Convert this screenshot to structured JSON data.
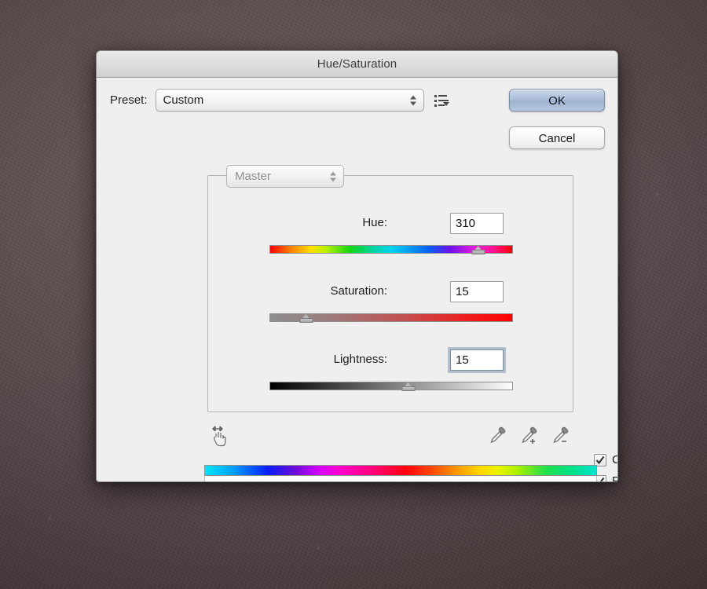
{
  "window": {
    "title": "Hue/Saturation"
  },
  "preset": {
    "label": "Preset:",
    "value": "Custom",
    "menu_icon": "preset-options-menu-icon",
    "stepper_icon": "stepper-arrows-icon"
  },
  "buttons": {
    "ok": "OK",
    "cancel": "Cancel"
  },
  "channel": {
    "value": "Master"
  },
  "sliders": [
    {
      "key": "hue",
      "label": "Hue:",
      "value": "310",
      "thumb_percent": 86,
      "focused": false,
      "track": "hue-spectrum"
    },
    {
      "key": "saturation",
      "label": "Saturation:",
      "value": "15",
      "thumb_percent": 15,
      "focused": false,
      "track": "gray-to-red"
    },
    {
      "key": "lightness",
      "label": "Lightness:",
      "value": "15",
      "thumb_percent": 57,
      "focused": true,
      "track": "black-to-white"
    }
  ],
  "tools": {
    "on_image_adjust": "on-image-adjustment-hand-icon",
    "eyedroppers": [
      {
        "name": "eyedropper-icon",
        "modifier": ""
      },
      {
        "name": "eyedropper-add-icon",
        "modifier": "+"
      },
      {
        "name": "eyedropper-subtract-icon",
        "modifier": "−"
      }
    ]
  },
  "checkboxes": [
    {
      "label": "Colorize",
      "checked": true
    },
    {
      "label": "Preview",
      "checked": true
    }
  ],
  "color_bars": {
    "input_spectrum": "full-hue-spectrum",
    "result_color": "#ad8a9c"
  },
  "colors": {
    "dialog_background": "#efefef",
    "default_button": "#aabdd8",
    "result_swatch": "#ad8a9c",
    "desktop": "#5e4e4e"
  }
}
